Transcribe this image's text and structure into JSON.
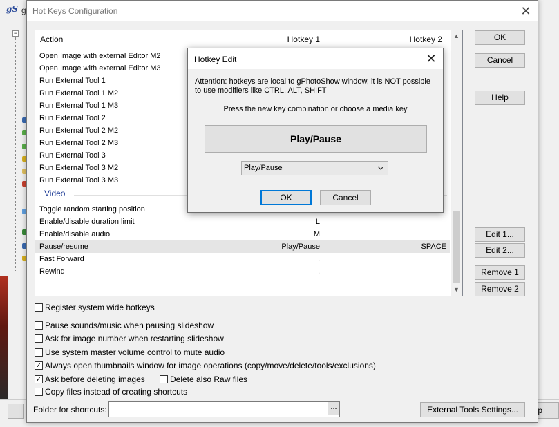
{
  "background": {
    "logo": "gS",
    "title_fragment": "g",
    "right_button_fragment": "elp"
  },
  "dialog": {
    "title": "Hot Keys Configuration",
    "close_glyph": "✕"
  },
  "list": {
    "headers": [
      "Action",
      "Hotkey 1",
      "Hotkey 2"
    ],
    "rows": [
      {
        "action": "Open Image with external Editor M2",
        "h1": "",
        "h2": ""
      },
      {
        "action": "Open Image with external Editor M3",
        "h1": "",
        "h2": ""
      },
      {
        "action": "Run External Tool 1",
        "h1": "",
        "h2": ""
      },
      {
        "action": "Run External Tool 1 M2",
        "h1": "",
        "h2": ""
      },
      {
        "action": "Run External Tool 1 M3",
        "h1": "",
        "h2": ""
      },
      {
        "action": "Run External Tool 2",
        "h1": "",
        "h2": ""
      },
      {
        "action": "Run External Tool 2 M2",
        "h1": "",
        "h2": ""
      },
      {
        "action": "Run External Tool 2 M3",
        "h1": "",
        "h2": ""
      },
      {
        "action": "Run External Tool 3",
        "h1": "",
        "h2": ""
      },
      {
        "action": "Run External Tool 3 M2",
        "h1": "",
        "h2": ""
      },
      {
        "action": "Run External Tool 3 M3",
        "h1": "",
        "h2": ""
      }
    ],
    "group": "Video",
    "video_rows": [
      {
        "action": "Toggle random starting position",
        "h1": "",
        "h2": ""
      },
      {
        "action": "Enable/disable duration limit",
        "h1": "L",
        "h2": ""
      },
      {
        "action": "Enable/disable audio",
        "h1": "M",
        "h2": ""
      },
      {
        "action": "Pause/resume",
        "h1": "Play/Pause",
        "h2": "SPACE"
      },
      {
        "action": "Fast Forward",
        "h1": ".",
        "h2": ""
      },
      {
        "action": "Rewind",
        "h1": ",",
        "h2": ""
      }
    ],
    "selected_row": "Pause/resume"
  },
  "buttons": {
    "ok": "OK",
    "cancel": "Cancel",
    "help": "Help",
    "edit1": "Edit 1...",
    "edit2": "Edit 2...",
    "remove1": "Remove 1",
    "remove2": "Remove 2",
    "external_tools": "External Tools Settings..."
  },
  "options": {
    "register_system": {
      "label": "Register system wide hotkeys",
      "checked": false
    },
    "pause_sounds": {
      "label": "Pause sounds/music when pausing slideshow",
      "checked": false
    },
    "ask_image_number": {
      "label": "Ask for image number when restarting slideshow",
      "checked": false
    },
    "system_volume": {
      "label": "Use system master volume control to mute audio",
      "checked": false
    },
    "always_thumbnails": {
      "label": "Always open thumbnails window for image operations (copy/move/delete/tools/exclusions)",
      "checked": true
    },
    "ask_before_delete": {
      "label": "Ask before deleting images",
      "checked": true
    },
    "delete_raw": {
      "label": "Delete also Raw files",
      "checked": false
    },
    "copy_files": {
      "label": "Copy files instead of creating shortcuts",
      "checked": false
    }
  },
  "folder": {
    "label": "Folder for shortcuts:",
    "value": "",
    "browse": "..."
  },
  "modal": {
    "title": "Hotkey Edit",
    "close_glyph": "✕",
    "attention": "Attention: hotkeys are local to gPhotoShow window, it is NOT possible to use modifiers like CTRL, ALT, SHIFT",
    "press_text": "Press the new key combination or choose a media key",
    "current_key": "Play/Pause",
    "select_value": "Play/Pause",
    "ok": "OK",
    "cancel": "Cancel"
  }
}
